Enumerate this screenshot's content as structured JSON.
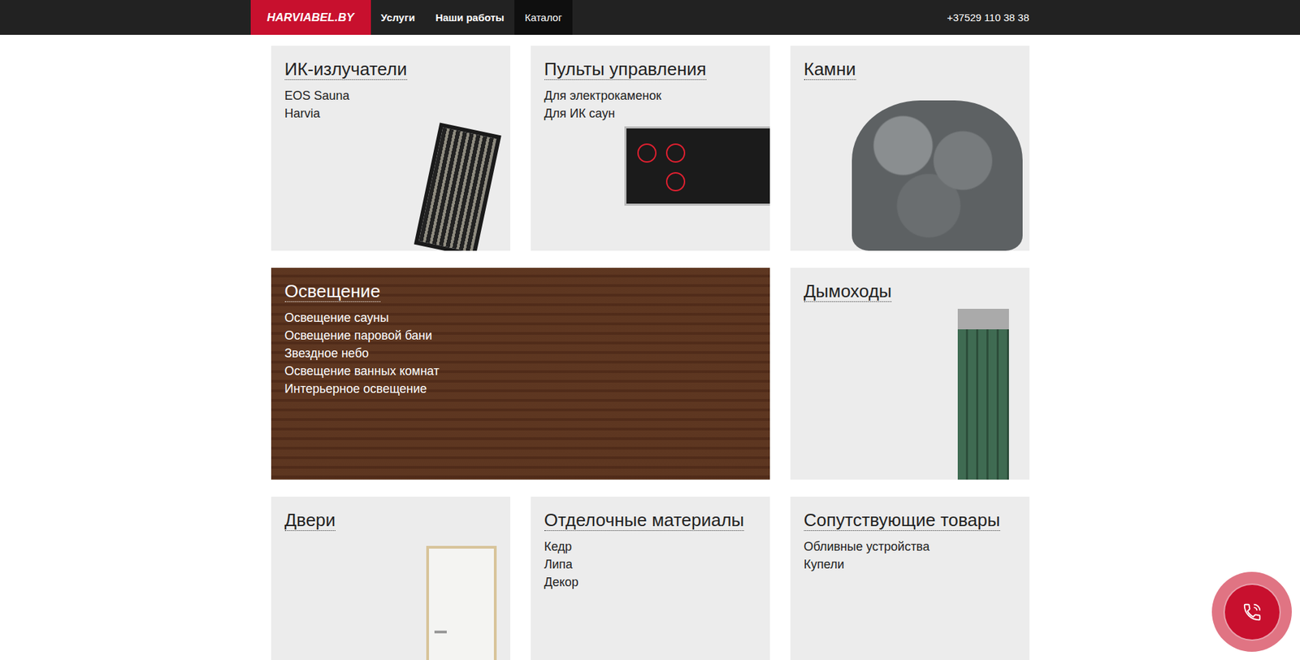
{
  "header": {
    "logo": "HARVIABEL.BY",
    "nav": [
      {
        "label": "Услуги",
        "selected": false
      },
      {
        "label": "Наши работы",
        "selected": false
      },
      {
        "label": "Каталог",
        "selected": true
      }
    ],
    "phone": "+37529 110 38 38"
  },
  "cards": [
    {
      "title": "ИК-излучатели",
      "kind": "product",
      "links": [
        "EOS Sauna",
        "Harvia"
      ]
    },
    {
      "title": "Пульты управления",
      "kind": "product",
      "links": [
        "Для электрокаменок",
        "Для ИК саун"
      ]
    },
    {
      "title": "Камни",
      "kind": "product",
      "links": []
    },
    {
      "title": "Освещение",
      "kind": "photo-wide",
      "links": [
        "Освещение сауны",
        "Освещение паровой бани",
        "Звездное небо",
        "Освещение ванных комнат",
        "Интерьерное освещение"
      ]
    },
    {
      "title": "Дымоходы",
      "kind": "product",
      "links": []
    },
    {
      "title": "Двери",
      "kind": "product",
      "links": []
    },
    {
      "title": "Отделочные материалы",
      "kind": "plain",
      "links": [
        "Кедр",
        "Липа",
        "Декор"
      ]
    },
    {
      "title": "Сопутствующие товары",
      "kind": "plain",
      "links": [
        "Обливные устройства",
        "Купели"
      ]
    }
  ]
}
